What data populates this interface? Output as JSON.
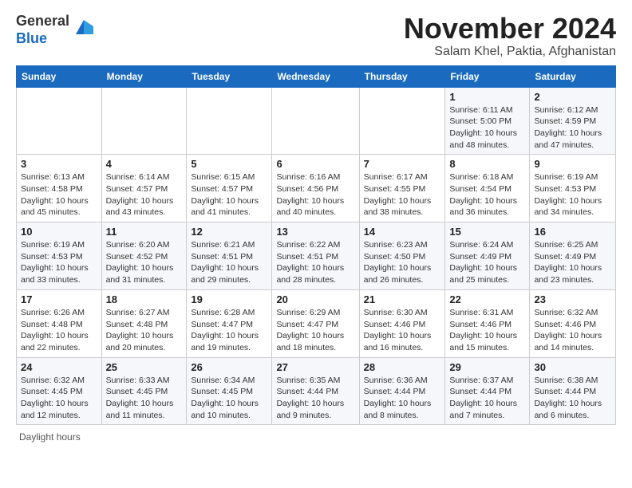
{
  "header": {
    "logo_line1": "General",
    "logo_line2": "Blue",
    "month_title": "November 2024",
    "location": "Salam Khel, Paktia, Afghanistan"
  },
  "calendar": {
    "days_of_week": [
      "Sunday",
      "Monday",
      "Tuesday",
      "Wednesday",
      "Thursday",
      "Friday",
      "Saturday"
    ],
    "weeks": [
      [
        {
          "day": "",
          "info": ""
        },
        {
          "day": "",
          "info": ""
        },
        {
          "day": "",
          "info": ""
        },
        {
          "day": "",
          "info": ""
        },
        {
          "day": "",
          "info": ""
        },
        {
          "day": "1",
          "info": "Sunrise: 6:11 AM\nSunset: 5:00 PM\nDaylight: 10 hours and 48 minutes."
        },
        {
          "day": "2",
          "info": "Sunrise: 6:12 AM\nSunset: 4:59 PM\nDaylight: 10 hours and 47 minutes."
        }
      ],
      [
        {
          "day": "3",
          "info": "Sunrise: 6:13 AM\nSunset: 4:58 PM\nDaylight: 10 hours and 45 minutes."
        },
        {
          "day": "4",
          "info": "Sunrise: 6:14 AM\nSunset: 4:57 PM\nDaylight: 10 hours and 43 minutes."
        },
        {
          "day": "5",
          "info": "Sunrise: 6:15 AM\nSunset: 4:57 PM\nDaylight: 10 hours and 41 minutes."
        },
        {
          "day": "6",
          "info": "Sunrise: 6:16 AM\nSunset: 4:56 PM\nDaylight: 10 hours and 40 minutes."
        },
        {
          "day": "7",
          "info": "Sunrise: 6:17 AM\nSunset: 4:55 PM\nDaylight: 10 hours and 38 minutes."
        },
        {
          "day": "8",
          "info": "Sunrise: 6:18 AM\nSunset: 4:54 PM\nDaylight: 10 hours and 36 minutes."
        },
        {
          "day": "9",
          "info": "Sunrise: 6:19 AM\nSunset: 4:53 PM\nDaylight: 10 hours and 34 minutes."
        }
      ],
      [
        {
          "day": "10",
          "info": "Sunrise: 6:19 AM\nSunset: 4:53 PM\nDaylight: 10 hours and 33 minutes."
        },
        {
          "day": "11",
          "info": "Sunrise: 6:20 AM\nSunset: 4:52 PM\nDaylight: 10 hours and 31 minutes."
        },
        {
          "day": "12",
          "info": "Sunrise: 6:21 AM\nSunset: 4:51 PM\nDaylight: 10 hours and 29 minutes."
        },
        {
          "day": "13",
          "info": "Sunrise: 6:22 AM\nSunset: 4:51 PM\nDaylight: 10 hours and 28 minutes."
        },
        {
          "day": "14",
          "info": "Sunrise: 6:23 AM\nSunset: 4:50 PM\nDaylight: 10 hours and 26 minutes."
        },
        {
          "day": "15",
          "info": "Sunrise: 6:24 AM\nSunset: 4:49 PM\nDaylight: 10 hours and 25 minutes."
        },
        {
          "day": "16",
          "info": "Sunrise: 6:25 AM\nSunset: 4:49 PM\nDaylight: 10 hours and 23 minutes."
        }
      ],
      [
        {
          "day": "17",
          "info": "Sunrise: 6:26 AM\nSunset: 4:48 PM\nDaylight: 10 hours and 22 minutes."
        },
        {
          "day": "18",
          "info": "Sunrise: 6:27 AM\nSunset: 4:48 PM\nDaylight: 10 hours and 20 minutes."
        },
        {
          "day": "19",
          "info": "Sunrise: 6:28 AM\nSunset: 4:47 PM\nDaylight: 10 hours and 19 minutes."
        },
        {
          "day": "20",
          "info": "Sunrise: 6:29 AM\nSunset: 4:47 PM\nDaylight: 10 hours and 18 minutes."
        },
        {
          "day": "21",
          "info": "Sunrise: 6:30 AM\nSunset: 4:46 PM\nDaylight: 10 hours and 16 minutes."
        },
        {
          "day": "22",
          "info": "Sunrise: 6:31 AM\nSunset: 4:46 PM\nDaylight: 10 hours and 15 minutes."
        },
        {
          "day": "23",
          "info": "Sunrise: 6:32 AM\nSunset: 4:46 PM\nDaylight: 10 hours and 14 minutes."
        }
      ],
      [
        {
          "day": "24",
          "info": "Sunrise: 6:32 AM\nSunset: 4:45 PM\nDaylight: 10 hours and 12 minutes."
        },
        {
          "day": "25",
          "info": "Sunrise: 6:33 AM\nSunset: 4:45 PM\nDaylight: 10 hours and 11 minutes."
        },
        {
          "day": "26",
          "info": "Sunrise: 6:34 AM\nSunset: 4:45 PM\nDaylight: 10 hours and 10 minutes."
        },
        {
          "day": "27",
          "info": "Sunrise: 6:35 AM\nSunset: 4:44 PM\nDaylight: 10 hours and 9 minutes."
        },
        {
          "day": "28",
          "info": "Sunrise: 6:36 AM\nSunset: 4:44 PM\nDaylight: 10 hours and 8 minutes."
        },
        {
          "day": "29",
          "info": "Sunrise: 6:37 AM\nSunset: 4:44 PM\nDaylight: 10 hours and 7 minutes."
        },
        {
          "day": "30",
          "info": "Sunrise: 6:38 AM\nSunset: 4:44 PM\nDaylight: 10 hours and 6 minutes."
        }
      ]
    ]
  },
  "footer": {
    "note": "Daylight hours"
  }
}
